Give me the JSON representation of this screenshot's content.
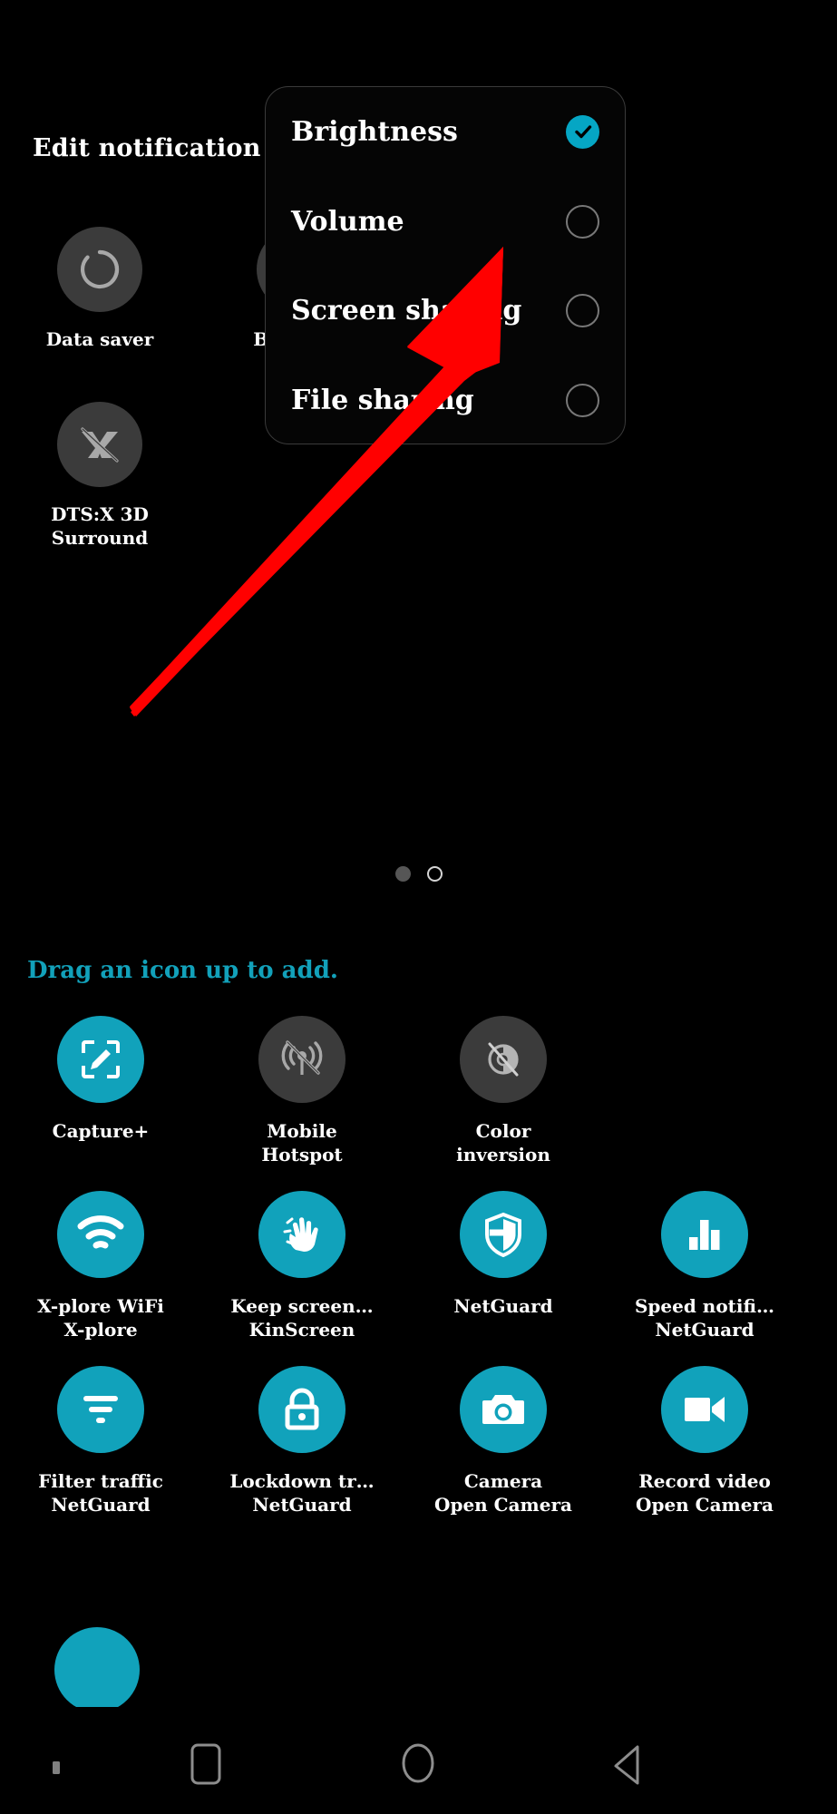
{
  "theme": {
    "background": "#000000",
    "accent_teal": "#11a2bb",
    "accent_teal_dialog": "#05a6c4",
    "inactive_gray": "#3b3b3b",
    "hint_text": "#12a1ba",
    "arrow_red": "#ff0000"
  },
  "header": {
    "title": "Edit notification panel"
  },
  "active_tiles": [
    {
      "label": "Data saver",
      "icon": "data-saver-icon",
      "state": "off"
    },
    {
      "label": "Battery saver\nExtended",
      "icon": "battery-saver-icon",
      "state": "off"
    },
    {
      "label": "DTS:X 3D\nSurround",
      "icon": "dtsx-icon",
      "state": "off"
    }
  ],
  "page_indicator": {
    "total": 2,
    "current": 2,
    "dots": [
      "filled",
      "hollow"
    ]
  },
  "drag_hint": "Drag an icon up to add.",
  "tray_items": [
    {
      "label": "Capture+",
      "sublabel": "",
      "icon": "capture-plus-icon",
      "state": "on"
    },
    {
      "label": "Mobile",
      "sublabel": "Hotspot",
      "icon": "mobile-hotspot-off-icon",
      "state": "off"
    },
    {
      "label": "Color",
      "sublabel": "inversion",
      "icon": "color-inversion-off-icon",
      "state": "off"
    },
    {
      "label": "X-plore WiFi",
      "sublabel": "X-plore",
      "icon": "wifi-icon",
      "state": "on"
    },
    {
      "label": "Keep screen…",
      "sublabel": "KinScreen",
      "icon": "hand-icon",
      "state": "on"
    },
    {
      "label": "NetGuard",
      "sublabel": "",
      "icon": "shield-icon",
      "state": "on"
    },
    {
      "label": "Speed notifi…",
      "sublabel": "NetGuard",
      "icon": "bar-chart-icon",
      "state": "on"
    },
    {
      "label": "Filter traffic",
      "sublabel": "NetGuard",
      "icon": "filter-icon",
      "state": "on"
    },
    {
      "label": "Lockdown tr…",
      "sublabel": "NetGuard",
      "icon": "lock-icon",
      "state": "on"
    },
    {
      "label": "Camera",
      "sublabel": "Open Camera",
      "icon": "camera-icon",
      "state": "on"
    },
    {
      "label": "Record video",
      "sublabel": "Open Camera",
      "icon": "video-camera-icon",
      "state": "on"
    }
  ],
  "dialog": {
    "options": [
      {
        "label": "Brightness",
        "checked": true
      },
      {
        "label": "Volume",
        "checked": false
      },
      {
        "label": "Screen sharing",
        "checked": false
      },
      {
        "label": "File sharing",
        "checked": false
      }
    ]
  },
  "navbar": {
    "items": [
      {
        "name": "menu-dot-button",
        "icon": "dot-icon"
      },
      {
        "name": "recents-button",
        "icon": "square-icon"
      },
      {
        "name": "home-button",
        "icon": "circle-icon"
      },
      {
        "name": "back-button",
        "icon": "triangle-back-icon"
      }
    ]
  },
  "annotation": {
    "type": "red-arrow",
    "points_to": "Screen sharing / Volume option in dialog"
  }
}
